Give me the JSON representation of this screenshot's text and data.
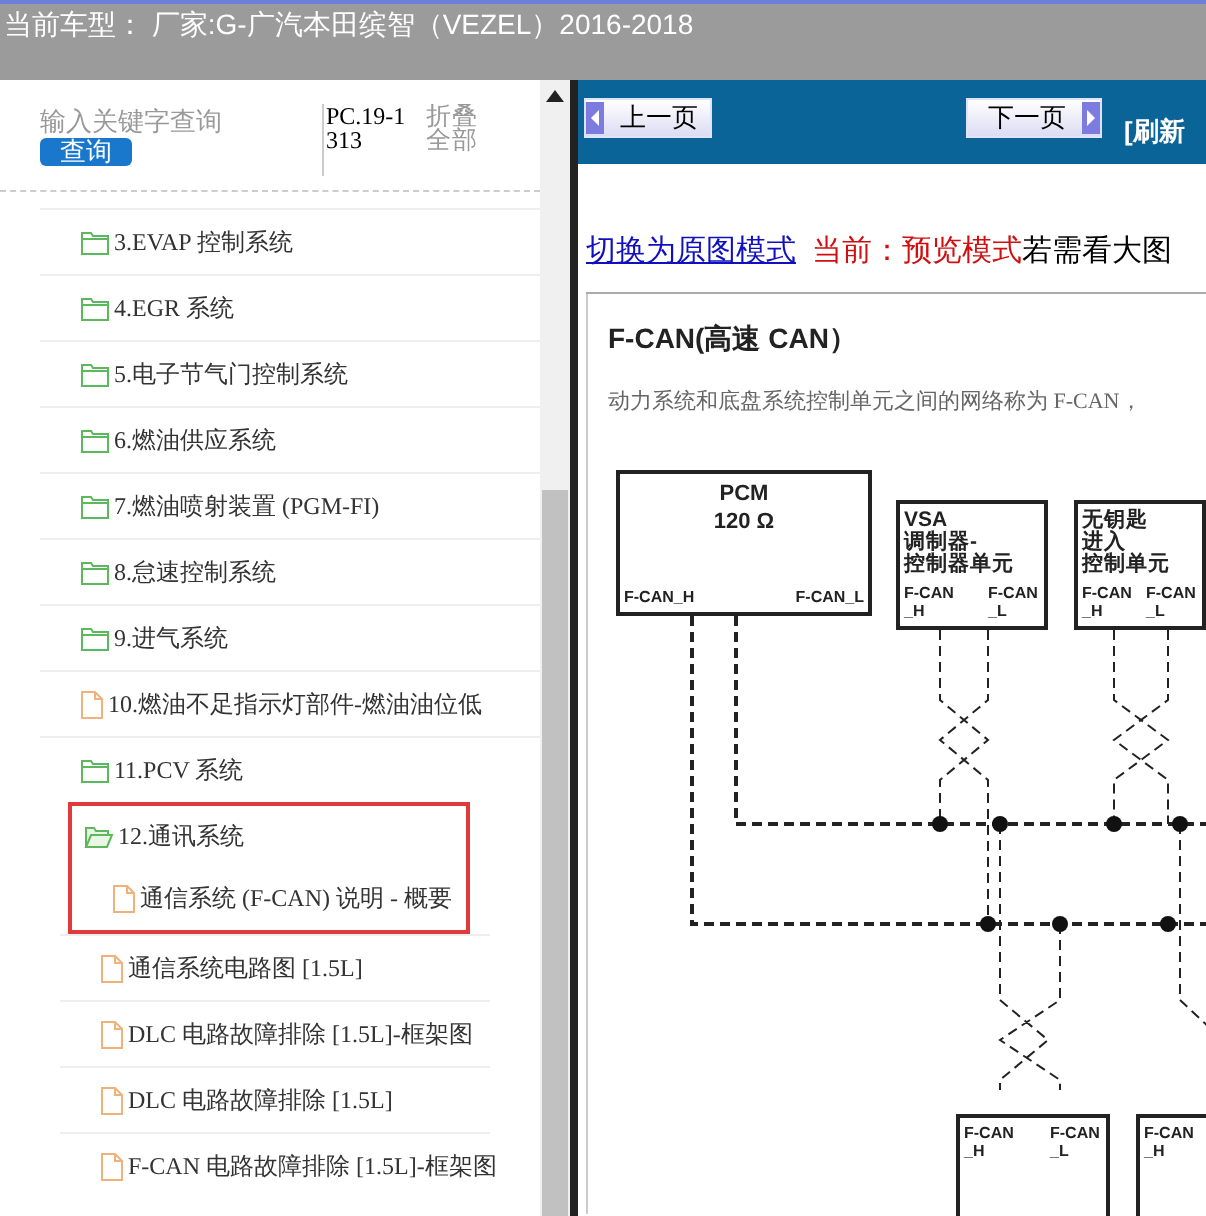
{
  "header": {
    "title": "当前车型： 厂家:G-广汽本田缤智（VEZEL）2016-2018"
  },
  "search": {
    "placeholder": "输入关键字查询",
    "button": "查询",
    "code": "PC.19-1313",
    "collapse_all": "折叠全部"
  },
  "tree": [
    {
      "label": "3.EVAP 控制系统",
      "kind": "folder",
      "expanded": false,
      "highlighted": false
    },
    {
      "label": "4.EGR 系统",
      "kind": "folder",
      "expanded": false,
      "highlighted": false
    },
    {
      "label": "5.电子节气门控制系统",
      "kind": "folder",
      "expanded": false,
      "highlighted": false
    },
    {
      "label": "6.燃油供应系统",
      "kind": "folder",
      "expanded": false,
      "highlighted": false
    },
    {
      "label": "7.燃油喷射装置 (PGM-FI)",
      "kind": "folder",
      "expanded": false,
      "highlighted": false
    },
    {
      "label": "8.怠速控制系统",
      "kind": "folder",
      "expanded": false,
      "highlighted": false
    },
    {
      "label": "9.进气系统",
      "kind": "folder",
      "expanded": false,
      "highlighted": false
    },
    {
      "label": "10.燃油不足指示灯部件-燃油油位低",
      "kind": "file",
      "highlighted": false
    },
    {
      "label": "11.PCV 系统",
      "kind": "folder",
      "expanded": false,
      "highlighted": false
    },
    {
      "label": "12.通讯系统",
      "kind": "folder",
      "expanded": true,
      "highlighted": true,
      "children": [
        {
          "label": "通信系统 (F-CAN) 说明 - 概要",
          "kind": "file",
          "highlighted": true
        },
        {
          "label": "通信系统电路图 [1.5L]",
          "kind": "file",
          "highlighted": false
        },
        {
          "label": "DLC 电路故障排除 [1.5L]-框架图",
          "kind": "file",
          "highlighted": false
        },
        {
          "label": "DLC 电路故障排除 [1.5L]",
          "kind": "file",
          "highlighted": false
        },
        {
          "label": "F-CAN 电路故障排除 [1.5L]-框架图",
          "kind": "file",
          "highlighted": false
        }
      ]
    }
  ],
  "toolbar": {
    "prev": "上一页",
    "next": "下一页",
    "refresh": "[刷新"
  },
  "mode_line": {
    "link": "切换为原图模式",
    "current": "当前：预览模式",
    "hint": "若需看大图"
  },
  "document": {
    "heading": "F-CAN(高速 CAN）",
    "intro": "动力系统和底盘系统控制单元之间的网络称为 F-CAN，",
    "modules": [
      {
        "label_lines": [
          "PCM",
          "120 Ω"
        ],
        "pins": [
          "F-CAN_H",
          "F-CAN_L"
        ]
      },
      {
        "label_lines": [
          "VSA",
          "调制器-",
          "控制器单元"
        ],
        "pins": [
          "F-CAN _H",
          "F-CAN _L"
        ]
      },
      {
        "label_lines": [
          "无钥匙",
          "进入",
          "控制单元"
        ],
        "pins": [
          "F-CAN _H",
          "F-CAN _L"
        ]
      },
      {
        "pins": [
          "F-CAN _H",
          "F-CAN _L"
        ]
      },
      {
        "pins": [
          "F-CAN _H"
        ]
      }
    ]
  }
}
